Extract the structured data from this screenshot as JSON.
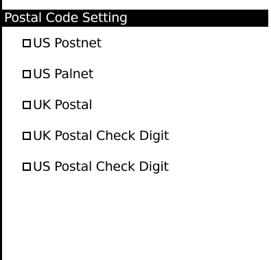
{
  "window": {
    "title": "Postal Code Setting"
  },
  "options": [
    {
      "label": "US Postnet",
      "checked": false
    },
    {
      "label": "US Palnet",
      "checked": false
    },
    {
      "label": "UK Postal",
      "checked": false
    },
    {
      "label": "UK Postal Check Digit",
      "checked": false
    },
    {
      "label": "US Postal Check Digit",
      "checked": false
    }
  ]
}
